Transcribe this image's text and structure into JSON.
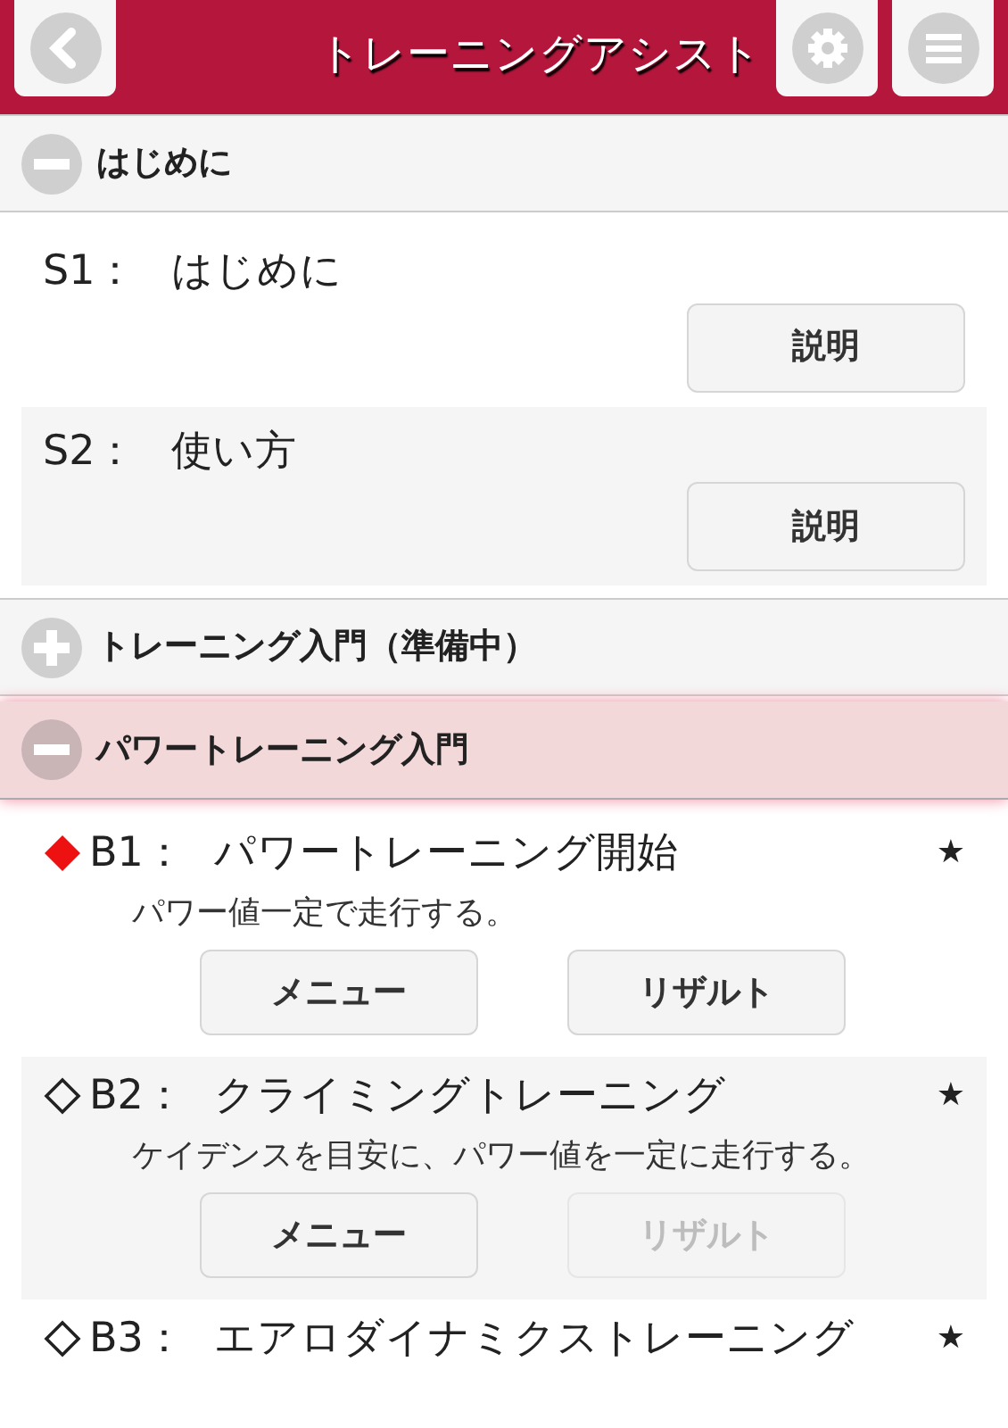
{
  "header": {
    "title": "トレーニングアシスト"
  },
  "sections": [
    {
      "title": "はじめに",
      "expanded": true,
      "highlighted": false,
      "items": [
        {
          "kind": "intro",
          "code": "S1：",
          "label": "はじめに",
          "button": "説明"
        },
        {
          "kind": "intro",
          "code": "S2：",
          "label": "使い方",
          "button": "説明"
        }
      ]
    },
    {
      "title": "トレーニング入門（準備中）",
      "expanded": false,
      "highlighted": false
    },
    {
      "title": "パワートレーニング入門",
      "expanded": true,
      "highlighted": true,
      "items": [
        {
          "kind": "training",
          "current": true,
          "code": "B1：",
          "label": "パワートレーニング開始",
          "badge": "★",
          "description": "パワー値一定で走行する。",
          "buttons": [
            {
              "label": "メニュー",
              "disabled": false
            },
            {
              "label": "リザルト",
              "disabled": false
            }
          ]
        },
        {
          "kind": "training",
          "current": false,
          "code": "B2：",
          "label": "クライミングトレーニング",
          "badge": "★",
          "description": "ケイデンスを目安に、パワー値を一定に走行する。",
          "buttons": [
            {
              "label": "メニュー",
              "disabled": false
            },
            {
              "label": "リザルト",
              "disabled": true
            }
          ]
        },
        {
          "kind": "training",
          "current": false,
          "code": "B3：",
          "label": "エアロダイナミクストレーニング",
          "badge": "★"
        }
      ]
    }
  ]
}
